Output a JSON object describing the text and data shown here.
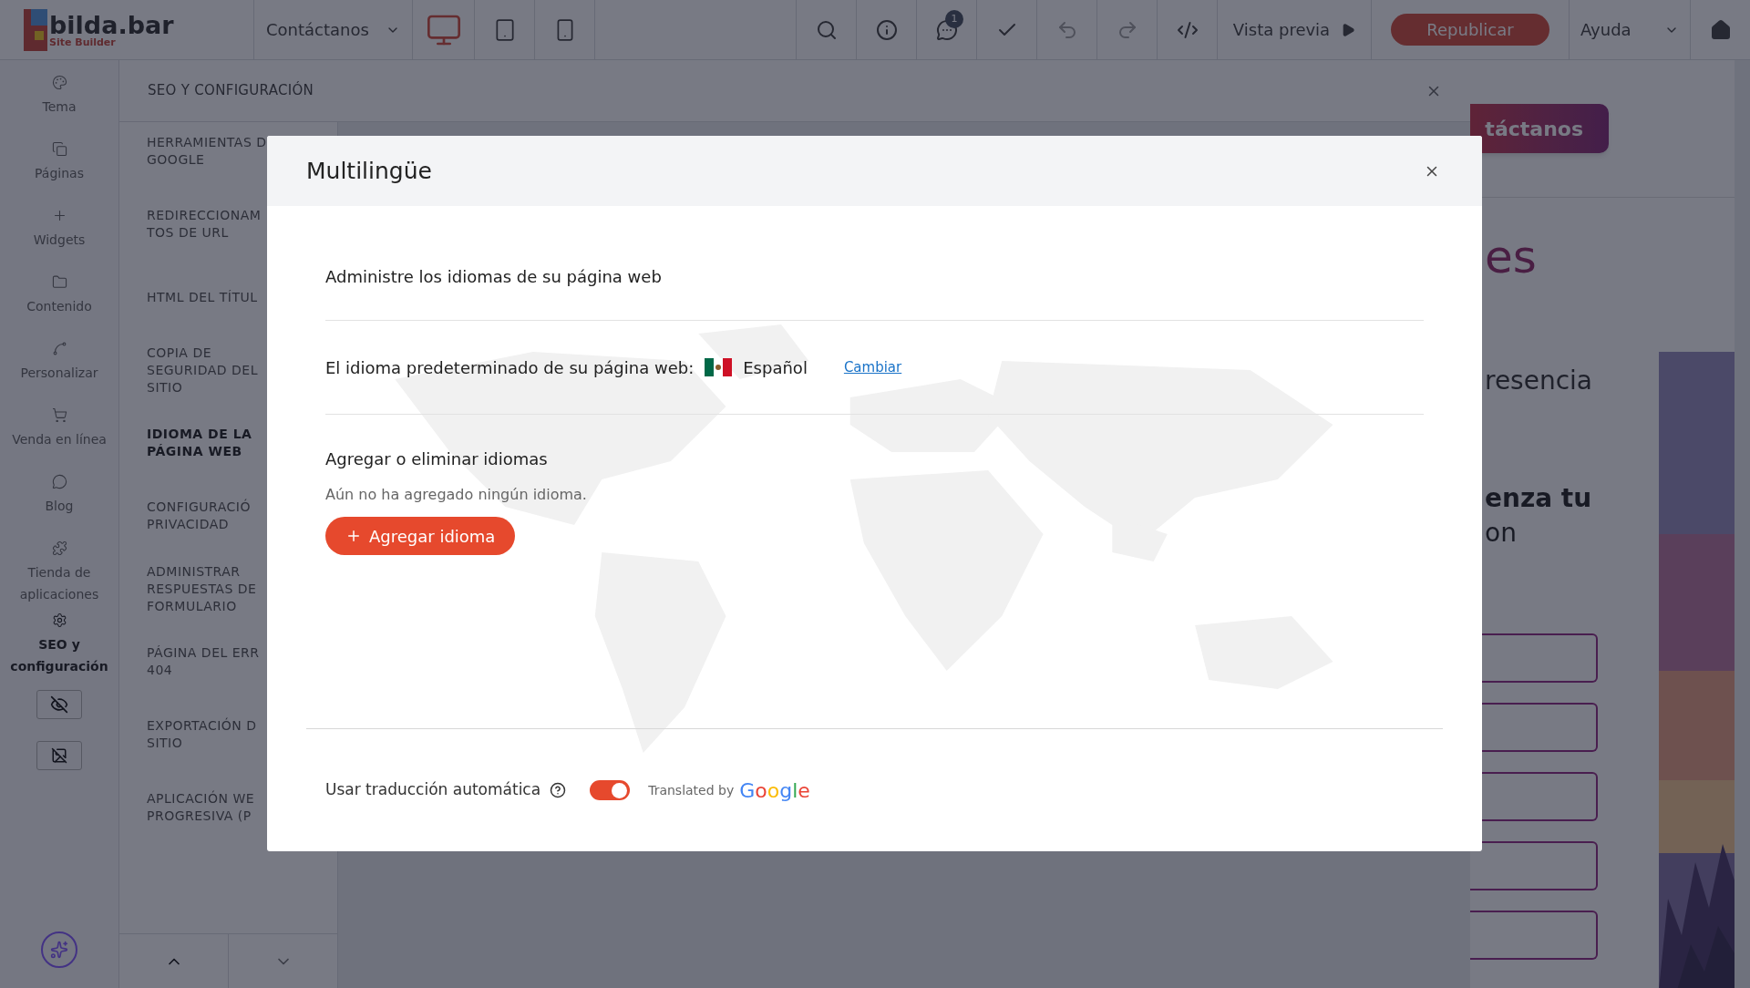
{
  "app": {
    "logo_name": "bilda.bar",
    "logo_tagline": "Site Builder"
  },
  "toolbar": {
    "page_selector": "Contáctanos",
    "devices": [
      {
        "kind": "desktop",
        "selected": true
      },
      {
        "kind": "tablet",
        "selected": false
      },
      {
        "kind": "phone",
        "selected": false
      }
    ],
    "notifications": "1",
    "preview": "Vista previa",
    "publish": "Republicar",
    "help": "Ayuda"
  },
  "sidebar": {
    "items": [
      {
        "kind": "palette",
        "label": "Tema",
        "selected": false
      },
      {
        "kind": "pages",
        "label": "Páginas",
        "selected": false
      },
      {
        "kind": "plus",
        "label": "Widgets",
        "selected": false
      },
      {
        "kind": "folder",
        "label": "Contenido",
        "selected": false
      },
      {
        "kind": "spline",
        "label": "Personalizar",
        "selected": false
      },
      {
        "kind": "cart",
        "label": "Venda en línea",
        "selected": false
      },
      {
        "kind": "chat",
        "label": "Blog",
        "selected": false
      },
      {
        "kind": "puzzle",
        "label": "Tienda de aplicaciones",
        "selected": false
      },
      {
        "kind": "gear",
        "label": "SEO y configuración",
        "selected": true
      }
    ]
  },
  "settings_panel": {
    "title": "SEO Y CONFIGURACIÓN",
    "items": [
      {
        "lines": [
          "HERRAMIENTAS D",
          "GOOGLE"
        ],
        "selected": false
      },
      {
        "lines": [
          "REDIRECCIONAM",
          "TOS DE URL"
        ],
        "selected": false
      },
      {
        "lines": [
          "HTML DEL TÍTUL"
        ],
        "selected": false
      },
      {
        "lines": [
          "COPIA DE",
          "SEGURIDAD DEL",
          "SITIO"
        ],
        "selected": false
      },
      {
        "lines": [
          "IDIOMA DE LA",
          "PÁGINA WEB"
        ],
        "selected": true
      },
      {
        "lines": [
          "CONFIGURACIÓ",
          "PRIVACIDAD"
        ],
        "selected": false
      },
      {
        "lines": [
          "ADMINISTRAR",
          "RESPUESTAS DE",
          "FORMULARIO"
        ],
        "selected": false
      },
      {
        "lines": [
          "PÁGINA DEL ERR",
          "404"
        ],
        "selected": false
      },
      {
        "lines": [
          "EXPORTACIÓN D",
          "SITIO"
        ],
        "selected": false
      },
      {
        "lines": [
          "APLICACIÓN WE",
          "PROGRESIVA (P"
        ],
        "selected": false
      }
    ]
  },
  "preview_page": {
    "button": "táctanos",
    "heading": "es",
    "text_1": "resencia",
    "text_2": "enza tu",
    "text_3": "on"
  },
  "modal": {
    "title": "Multilingüe",
    "section_title": "Administre los idiomas de su página web",
    "default_label": "El idioma predeterminado de su página web:",
    "default_language": "Español",
    "change_link": "Cambiar",
    "add_title": "Agregar o eliminar idiomas",
    "empty_text": "Aún no ha agregado ningún idioma.",
    "add_button": "Agregar idioma",
    "auto_translate_label": "Usar traducción automática",
    "auto_translate_on": true,
    "translated_by": "Translated by",
    "google": "Google"
  }
}
